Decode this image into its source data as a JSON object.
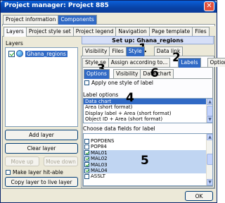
{
  "window": {
    "title": "Project manager: Project 885",
    "close_symbol": "✕"
  },
  "top_tabs": [
    {
      "label": "Project information",
      "active": false
    },
    {
      "label": "Components",
      "active": true
    }
  ],
  "main_tabs": [
    {
      "label": "Layers",
      "active": true
    },
    {
      "label": "Project style set"
    },
    {
      "label": "Project legend"
    },
    {
      "label": "Navigation"
    },
    {
      "label": "Page template"
    },
    {
      "label": "Files"
    }
  ],
  "layers_panel": {
    "heading": "Layers",
    "items": [
      {
        "label": "Ghana_regions",
        "checked": true
      }
    ],
    "buttons": {
      "add": "Add layer",
      "clear": "Clear layer",
      "move_up": "Move up",
      "move_down": "Move down",
      "copy": "Copy layer to live layer"
    },
    "hit_able": {
      "label": "Make layer hit-able",
      "checked": false
    }
  },
  "setup": {
    "title": "Set up: Ghana_regions"
  },
  "setup_tabs": [
    {
      "label": "Visibility"
    },
    {
      "label": "Files"
    },
    {
      "label": "Style",
      "active": true
    },
    {
      "label": "Data link"
    }
  ],
  "style_tabs": [
    {
      "label": "Style se"
    },
    {
      "label": "Assign according to..."
    },
    {
      "label": "Labels",
      "active": true
    },
    {
      "label": "Options"
    }
  ],
  "label_tabs": [
    {
      "label": "Options",
      "active": true
    },
    {
      "label": "Visibility"
    },
    {
      "label": "Data chart"
    }
  ],
  "apply_one_style": {
    "label": "Apply one style of label",
    "checked": false
  },
  "label_options": {
    "heading": "Label options",
    "items": [
      {
        "label": "Data chart",
        "selected": true
      },
      {
        "label": "Area (short format)"
      },
      {
        "label": "Display label + Area (short format)"
      },
      {
        "label": "Object ID + Area (short format)"
      }
    ]
  },
  "fields": {
    "heading": "Choose data fields for label",
    "items": [
      {
        "label": "POPDENS",
        "checked": false,
        "selected": false
      },
      {
        "label": "POP84",
        "checked": false,
        "selected": false
      },
      {
        "label": "MAL01",
        "checked": true,
        "selected": true
      },
      {
        "label": "MAL02",
        "checked": true,
        "selected": true
      },
      {
        "label": "MAL03",
        "checked": true,
        "selected": true
      },
      {
        "label": "MAL04",
        "checked": true,
        "selected": true
      },
      {
        "label": "ASSLT",
        "checked": false,
        "selected": false
      }
    ]
  },
  "ok_button": "OK",
  "annotations": [
    "1",
    "2",
    "3",
    "4",
    "5",
    "6"
  ]
}
